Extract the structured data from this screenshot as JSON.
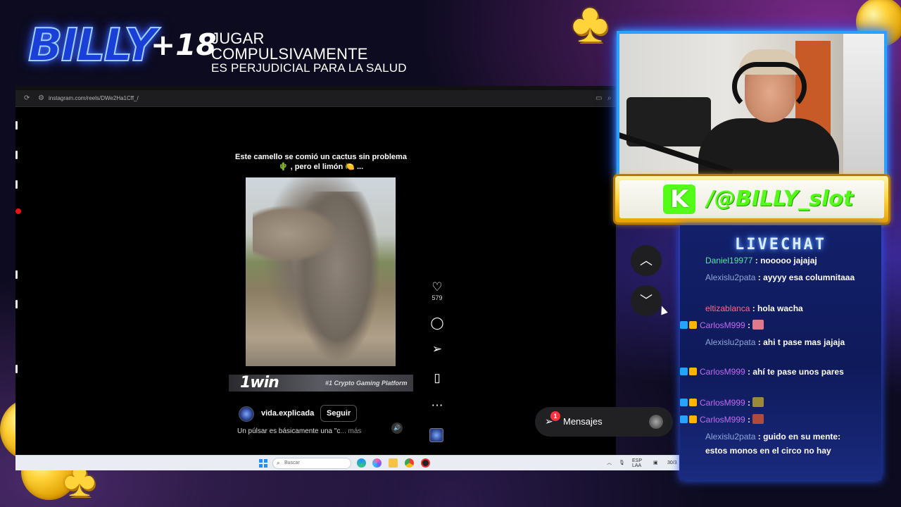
{
  "overlay": {
    "logo_text": "BILLY",
    "age_badge": "+18",
    "warning_line1": "JUGAR COMPULSIVAMENTE",
    "warning_line2": "ES PERJUDICIAL PARA LA SALUD"
  },
  "browser": {
    "url": "instagram.com/reels/DWe2Ha1Cff_/"
  },
  "reel": {
    "caption_line1": "Este camello se comió un cactus sin problema",
    "caption_line2": "🌵 , pero el limón 🍋 ...",
    "ad_brand": "1win",
    "ad_tagline": "#1 Crypto Gaming Platform",
    "author": "vida.explicada",
    "follow_label": "Seguir",
    "description": "Un púlsar es básicamente una \"c",
    "more_label": "... más",
    "like_count": "579"
  },
  "messages": {
    "label": "Mensajes",
    "badge": "1"
  },
  "taskbar": {
    "search_placeholder": "Buscar",
    "tray_lang": "ESP LAA",
    "tray_date": "30/3"
  },
  "kick": {
    "handle": "/@BILLY_slot"
  },
  "chat": {
    "title": "LIVECHAT",
    "messages": [
      {
        "user": "Daniel19977",
        "color": "#5fe0a8",
        "text": "nooooo jajajaj"
      },
      {
        "user": "Alexislu2pata",
        "color": "#8fa6d8",
        "text": "ayyyy esa columnitaaa"
      },
      {
        "user": "eltizablanca",
        "color": "#ff6b8a",
        "text": "hola wacha"
      },
      {
        "user": "CarlosM999",
        "color": "#c06cf0",
        "text": ""
      },
      {
        "user": "Alexislu2pata",
        "color": "#8fa6d8",
        "text": "ahi t pase mas jajaja"
      },
      {
        "user": "CarlosM999",
        "color": "#c06cf0",
        "text": "ahí te pase unos pares"
      },
      {
        "user": "CarlosM999",
        "color": "#c06cf0",
        "text": ""
      },
      {
        "user": "CarlosM999",
        "color": "#c06cf0",
        "text": ""
      },
      {
        "user": "Alexislu2pata",
        "color": "#8fa6d8",
        "text": "guido en su mente: estos monos en el circo no hay"
      }
    ]
  }
}
